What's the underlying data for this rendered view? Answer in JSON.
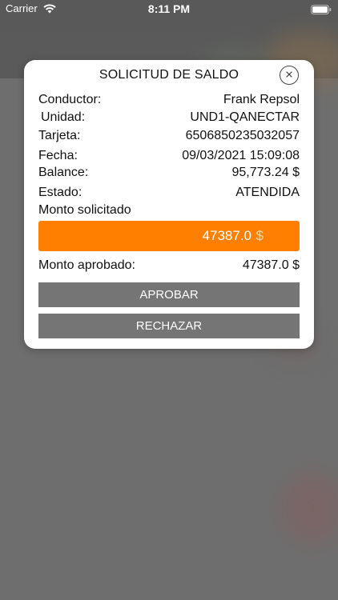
{
  "status_bar": {
    "carrier": "Carrier",
    "time": "8:11 PM",
    "wifi_icon": "wifi-icon",
    "battery_icon": "battery-icon"
  },
  "dialog": {
    "title": "SOLICITUD DE SALDO",
    "close_icon": "close-icon",
    "fields": {
      "conductor_label": "Conductor:",
      "conductor_value": "Frank Repsol",
      "unidad_label": "Unidad:",
      "unidad_value": "UND1-QANECTAR",
      "tarjeta_label": "Tarjeta:",
      "tarjeta_value": "6506850235032057",
      "fecha_label": "Fecha:",
      "fecha_value": "09/03/2021 15:09:08",
      "balance_label": "Balance:",
      "balance_value": "95,773.24 $",
      "estado_label": "Estado:",
      "estado_value": "ATENDIDA"
    },
    "monto_solicitado_label": "Monto solicitado",
    "monto_solicitado_value": "47387.0",
    "monto_solicitado_currency": "$",
    "monto_aprobado_label": "Monto aprobado:",
    "monto_aprobado_value": "47387.0 $",
    "approve_label": "APROBAR",
    "reject_label": "RECHAZAR"
  },
  "colors": {
    "accent": "#ff8000",
    "button_gray": "#757575",
    "overlay": "#6e6e6e"
  }
}
